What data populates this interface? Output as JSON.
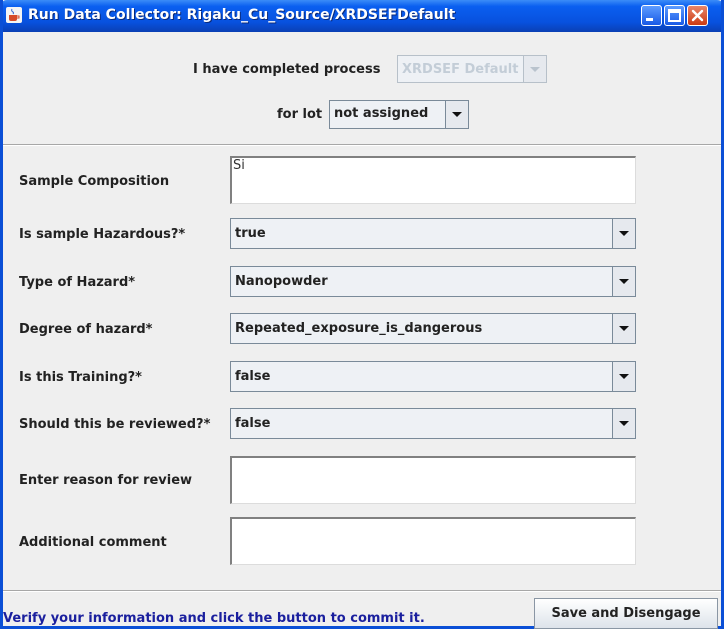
{
  "window": {
    "title": "Run Data Collector: Rigaku_Cu_Source/XRDSEFDefault",
    "icons": [
      "java-cup-icon",
      "minimize-icon",
      "maximize-icon",
      "close-icon"
    ],
    "colors": {
      "titlebar": "#0a5ff0",
      "status_text": "#1a1f9e"
    }
  },
  "header": {
    "process_label": "I have completed process",
    "process_value": "XRDSEF Default",
    "lot_label": "for lot",
    "lot_value": "not assigned"
  },
  "form": {
    "sample_composition": {
      "label": "Sample Composition",
      "value": "Si"
    },
    "hazardous": {
      "label": "Is sample Hazardous?*",
      "value": "true"
    },
    "hazard_type": {
      "label": "Type of Hazard*",
      "value": "Nanopowder"
    },
    "hazard_degree": {
      "label": "Degree of hazard*",
      "value": "Repeated_exposure_is_dangerous"
    },
    "training": {
      "label": "Is this Training?*",
      "value": "false"
    },
    "reviewed": {
      "label": "Should this be reviewed?*",
      "value": "false"
    },
    "review_reason": {
      "label": "Enter reason for review",
      "value": ""
    },
    "comment": {
      "label": "Additional comment",
      "value": ""
    }
  },
  "footer": {
    "save_label": "Save and Disengage",
    "status_text": "Verify your information and click the button to commit it."
  }
}
